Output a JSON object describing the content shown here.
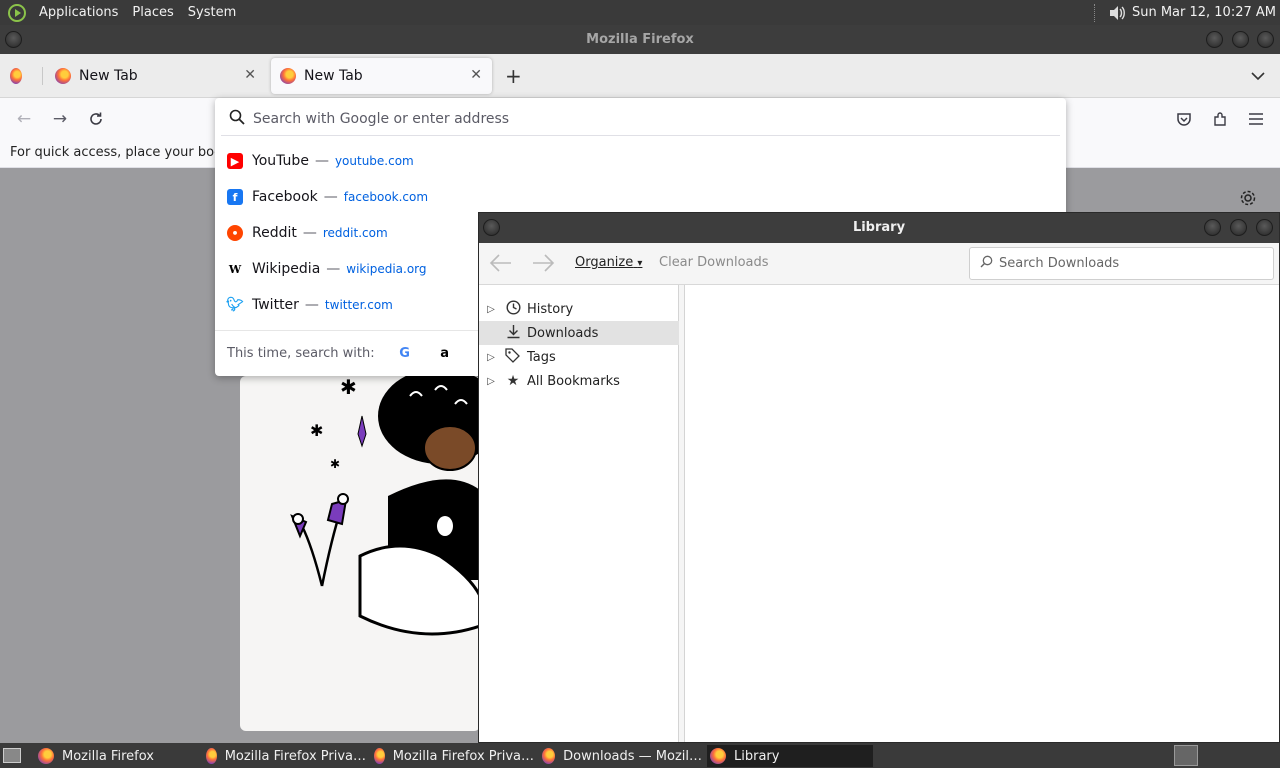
{
  "top_panel": {
    "menus": [
      "Applications",
      "Places",
      "System"
    ],
    "clock": "Sun Mar 12, 10:27 AM"
  },
  "firefox": {
    "window_title": "Mozilla Firefox",
    "tabs": [
      {
        "label": "New Tab"
      },
      {
        "label": "New Tab"
      }
    ],
    "bookmarks_hint": "For quick access, place your bookm",
    "url_placeholder": "Search with Google or enter address",
    "suggestions": [
      {
        "name": "YouTube",
        "dash": "—",
        "url": "youtube.com",
        "color": "#ff0000",
        "icon": "youtube-icon"
      },
      {
        "name": "Facebook",
        "dash": "—",
        "url": "facebook.com",
        "color": "#1877f2",
        "icon": "facebook-icon"
      },
      {
        "name": "Reddit",
        "dash": "—",
        "url": "reddit.com",
        "color": "#ff4500",
        "icon": "reddit-icon"
      },
      {
        "name": "Wikipedia",
        "dash": "—",
        "url": "wikipedia.org",
        "color": "#000000",
        "icon": "wikipedia-icon"
      },
      {
        "name": "Twitter",
        "dash": "—",
        "url": "twitter.com",
        "color": "#1da1f2",
        "icon": "twitter-icon"
      }
    ],
    "search_with_label": "This time, search with:"
  },
  "library": {
    "title": "Library",
    "organize_label": "Organize",
    "clear_downloads_label": "Clear Downloads",
    "search_placeholder": "Search Downloads",
    "tree": [
      {
        "label": "History",
        "icon": "clock-icon",
        "expandable": true
      },
      {
        "label": "Downloads",
        "icon": "download-icon",
        "expandable": false,
        "selected": true
      },
      {
        "label": "Tags",
        "icon": "tag-icon",
        "expandable": true
      },
      {
        "label": "All Bookmarks",
        "icon": "star-icon",
        "expandable": true
      }
    ]
  },
  "taskbar": {
    "tasks": [
      {
        "label": "Mozilla Firefox",
        "active": false
      },
      {
        "label": "Mozilla Firefox Priva…",
        "active": false
      },
      {
        "label": "Mozilla Firefox Priva…",
        "active": false
      },
      {
        "label": "Downloads — Mozil…",
        "active": false
      },
      {
        "label": "Library",
        "active": true
      }
    ]
  }
}
